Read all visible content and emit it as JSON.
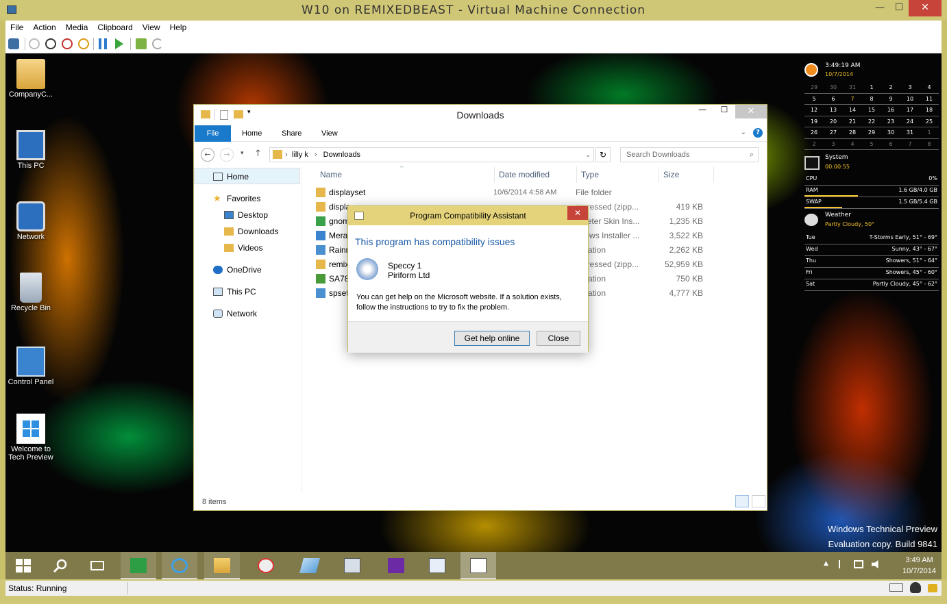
{
  "vm": {
    "title": "W10 on REMIXEDBEAST - Virtual Machine Connection",
    "menu": [
      "File",
      "Action",
      "Media",
      "Clipboard",
      "View",
      "Help"
    ],
    "status": "Status: Running",
    "close_label": "✕",
    "max_label": "☐",
    "min_label": "—"
  },
  "desktop_icons": [
    {
      "label": "CompanyC..."
    },
    {
      "label": "This PC"
    },
    {
      "label": "Network"
    },
    {
      "label": "Recycle Bin"
    },
    {
      "label": "Control Panel"
    },
    {
      "label": "Welcome to Tech Preview"
    }
  ],
  "explorer": {
    "title": "Downloads",
    "ribbon_tabs": [
      "File",
      "Home",
      "Share",
      "View"
    ],
    "breadcrumb": [
      "lilly k",
      "Downloads"
    ],
    "search_placeholder": "Search Downloads",
    "nav": {
      "home": "Home",
      "favorites": "Favorites",
      "desktop": "Desktop",
      "downloads": "Downloads",
      "videos": "Videos",
      "onedrive": "OneDrive",
      "thispc": "This PC",
      "network": "Network"
    },
    "columns": [
      "Name",
      "Date modified",
      "Type",
      "Size"
    ],
    "files": [
      {
        "name": "displayset",
        "date": "10/6/2014 4:58 AM",
        "type": "File folder",
        "size": ""
      },
      {
        "name": "displa",
        "date": "",
        "type": "mpressed (zipp...",
        "size": "419 KB"
      },
      {
        "name": "gnom",
        "date": "",
        "type": "nmeter Skin Ins...",
        "size": "1,235 KB"
      },
      {
        "name": "Mera",
        "date": "",
        "type": "ndows Installer ...",
        "size": "3,522 KB"
      },
      {
        "name": "Rainn",
        "date": "",
        "type": "plication",
        "size": "2,262 KB"
      },
      {
        "name": "remix",
        "date": "",
        "type": "mpressed (zipp...",
        "size": "52,959 KB"
      },
      {
        "name": "SA78",
        "date": "",
        "type": "plication",
        "size": "750 KB"
      },
      {
        "name": "spset",
        "date": "",
        "type": "plication",
        "size": "4,777 KB"
      }
    ],
    "item_count": "8 items",
    "close_label": "✕",
    "max_label": "☐",
    "min_label": "—"
  },
  "dialog": {
    "title": "Program Compatibility Assistant",
    "heading": "This program has compatibility issues",
    "program_name": "Speccy 1",
    "publisher": "Piriform Ltd",
    "message": "You can get help on the Microsoft website.  If a solution exists, follow the instructions to try to fix the problem.",
    "help_button": "Get help online",
    "close_button": "Close",
    "close_x": "✕"
  },
  "gadgets": {
    "time": "3:49:19 AM",
    "date": "10/7/2014",
    "calendar": [
      [
        "29",
        "30",
        "31",
        "1",
        "2",
        "3",
        "4"
      ],
      [
        "5",
        "6",
        "7",
        "8",
        "9",
        "10",
        "11"
      ],
      [
        "12",
        "13",
        "14",
        "15",
        "16",
        "17",
        "18"
      ],
      [
        "19",
        "20",
        "21",
        "22",
        "23",
        "24",
        "25"
      ],
      [
        "26",
        "27",
        "28",
        "29",
        "30",
        "31",
        "1"
      ],
      [
        "2",
        "3",
        "4",
        "5",
        "6",
        "7",
        "8"
      ]
    ],
    "system_label": "System",
    "uptime": "00:00:55",
    "cpu_label": "CPU",
    "cpu_value": "0%",
    "cpu_level": 0,
    "ram_label": "RAM",
    "ram_value": "1.6 GB/4.0 GB",
    "ram_level": 0.4,
    "swap_label": "SWAP",
    "swap_value": "1.5 GB/5.4 GB",
    "swap_level": 0.28,
    "weather_label": "Weather",
    "weather_now": "Partly Cloudy, 50°",
    "forecast": [
      {
        "day": "Tue",
        "text": "T-Storms Early, 51° - 69°"
      },
      {
        "day": "Wed",
        "text": "Sunny, 43° - 67°"
      },
      {
        "day": "Thu",
        "text": "Showers, 51° - 64°"
      },
      {
        "day": "Fri",
        "text": "Showers, 45° - 60°"
      },
      {
        "day": "Sat",
        "text": "Partly Cloudy, 45° - 62°"
      }
    ]
  },
  "watermark": {
    "line1": "Windows Technical Preview",
    "line2": "Evaluation copy. Build 9841"
  },
  "taskbar": {
    "time": "3:49 AM",
    "date": "10/7/2014"
  }
}
